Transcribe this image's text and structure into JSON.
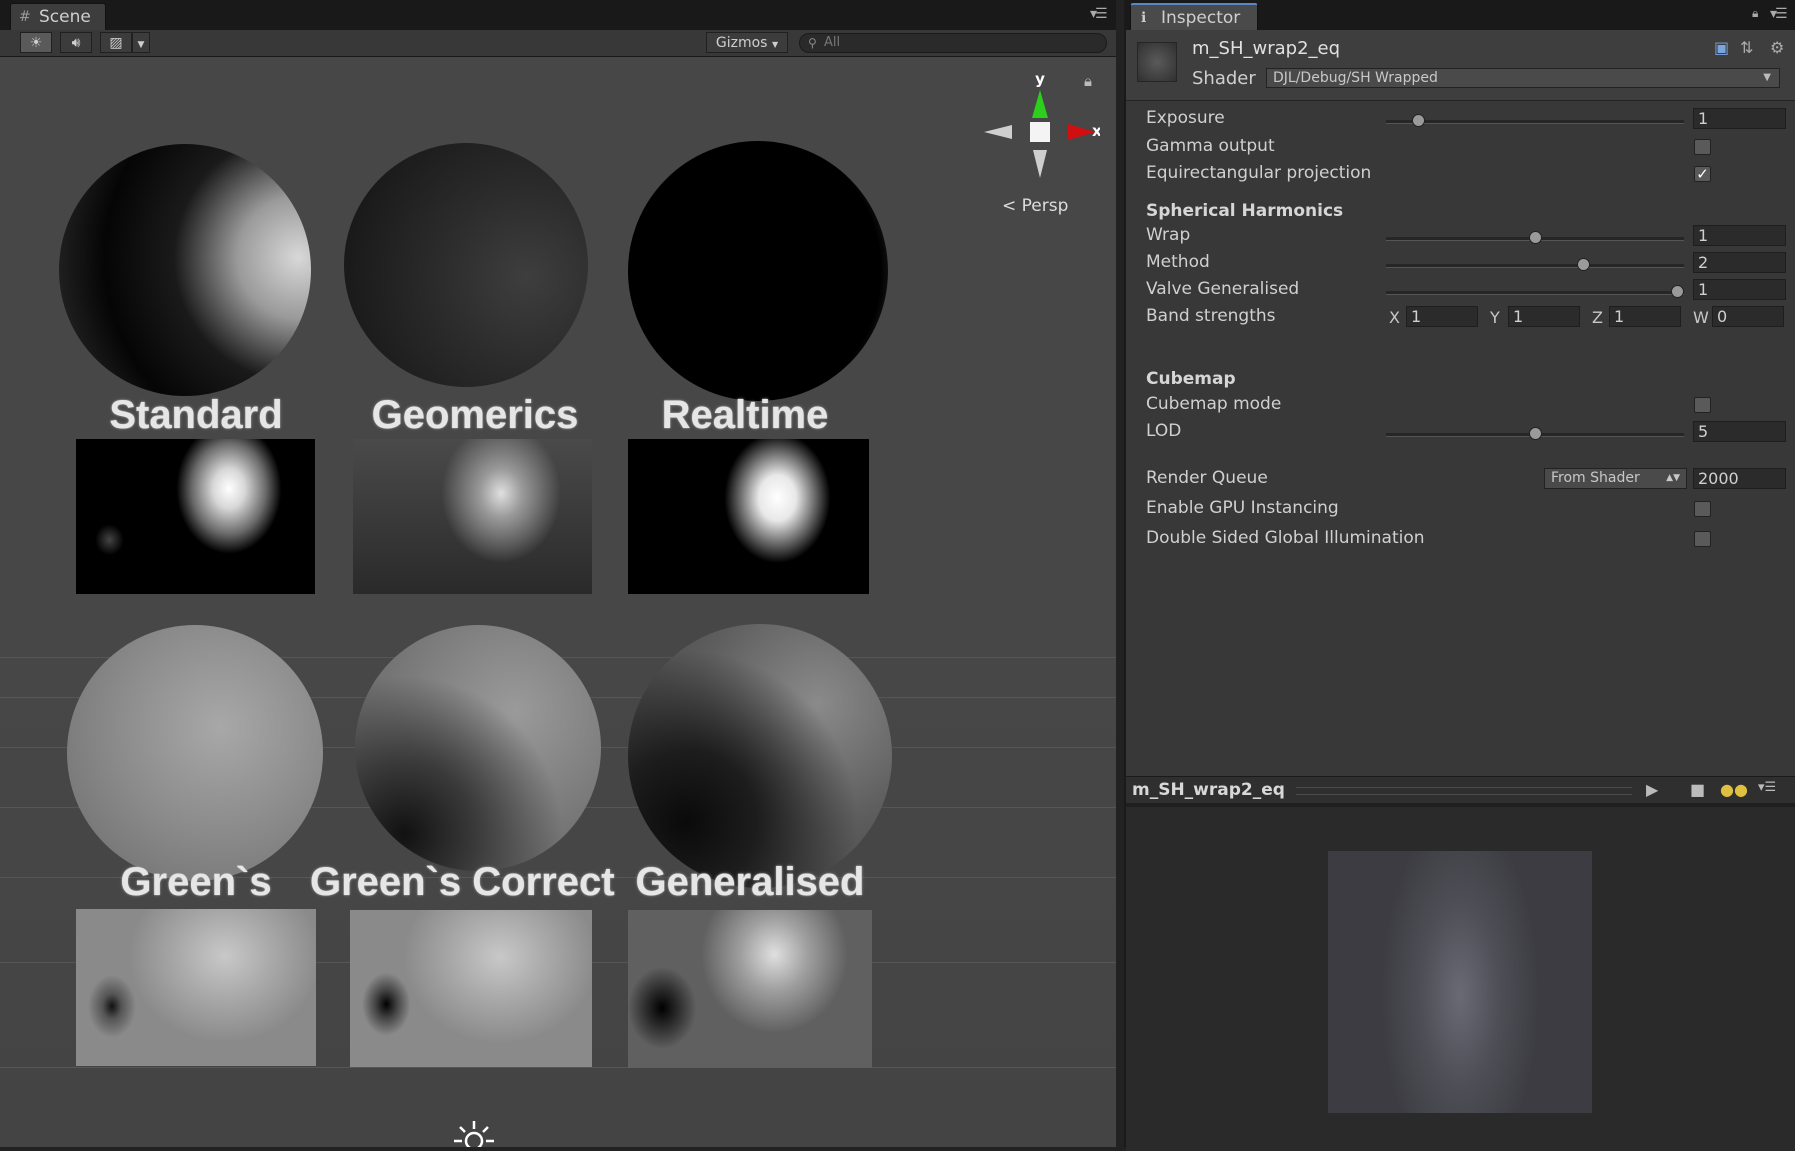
{
  "scene": {
    "tab_label": "Scene",
    "toolbar": {
      "gizmos_label": "Gizmos",
      "search_placeholder": "All"
    },
    "persp_label": "Persp",
    "gizmo_axes": {
      "y": "y",
      "x": "x"
    },
    "objects": [
      {
        "label": "Standard"
      },
      {
        "label": "Geomerics"
      },
      {
        "label": "Realtime"
      },
      {
        "label": "Green`s"
      },
      {
        "label": "Green`s Correct"
      },
      {
        "label": "Generalised"
      }
    ]
  },
  "inspector": {
    "tab_label": "Inspector",
    "material_name": "m_SH_wrap2_eq",
    "shader_label": "Shader",
    "shader_value": "DJL/Debug/SH Wrapped",
    "properties": {
      "exposure": {
        "label": "Exposure",
        "value": "1",
        "level": 0.09
      },
      "gamma_output": {
        "label": "Gamma output",
        "checked": false
      },
      "equirect": {
        "label": "Equirectangular projection",
        "checked": true
      },
      "sh_section": "Spherical Harmonics",
      "wrap": {
        "label": "Wrap",
        "value": "1",
        "level": 0.5
      },
      "method": {
        "label": "Method",
        "value": "2",
        "level": 0.67
      },
      "valve": {
        "label": "Valve Generalised",
        "value": "1",
        "level": 1.0
      },
      "band_strengths": {
        "label": "Band strengths",
        "x_label": "X",
        "x": "1",
        "y_label": "Y",
        "y": "1",
        "z_label": "Z",
        "z": "1",
        "w_label": "W",
        "w": "0"
      },
      "cubemap_section": "Cubemap",
      "cubemap_mode": {
        "label": "Cubemap mode",
        "checked": false
      },
      "lod": {
        "label": "LOD",
        "value": "5",
        "level": 0.5
      },
      "render_queue": {
        "label": "Render Queue",
        "dropdown": "From Shader",
        "value": "2000"
      },
      "gpu_instancing": {
        "label": "Enable GPU Instancing",
        "checked": false
      },
      "double_sided_gi": {
        "label": "Double Sided Global Illumination",
        "checked": false
      }
    },
    "preview": {
      "title": "m_SH_wrap2_eq"
    }
  },
  "colors": {
    "scene_bg": "#474747",
    "inspector_bg": "#383838",
    "accent_tab": "#5a86c8",
    "gizmo_x": "#d01010",
    "gizmo_y": "#2ccf1c"
  }
}
